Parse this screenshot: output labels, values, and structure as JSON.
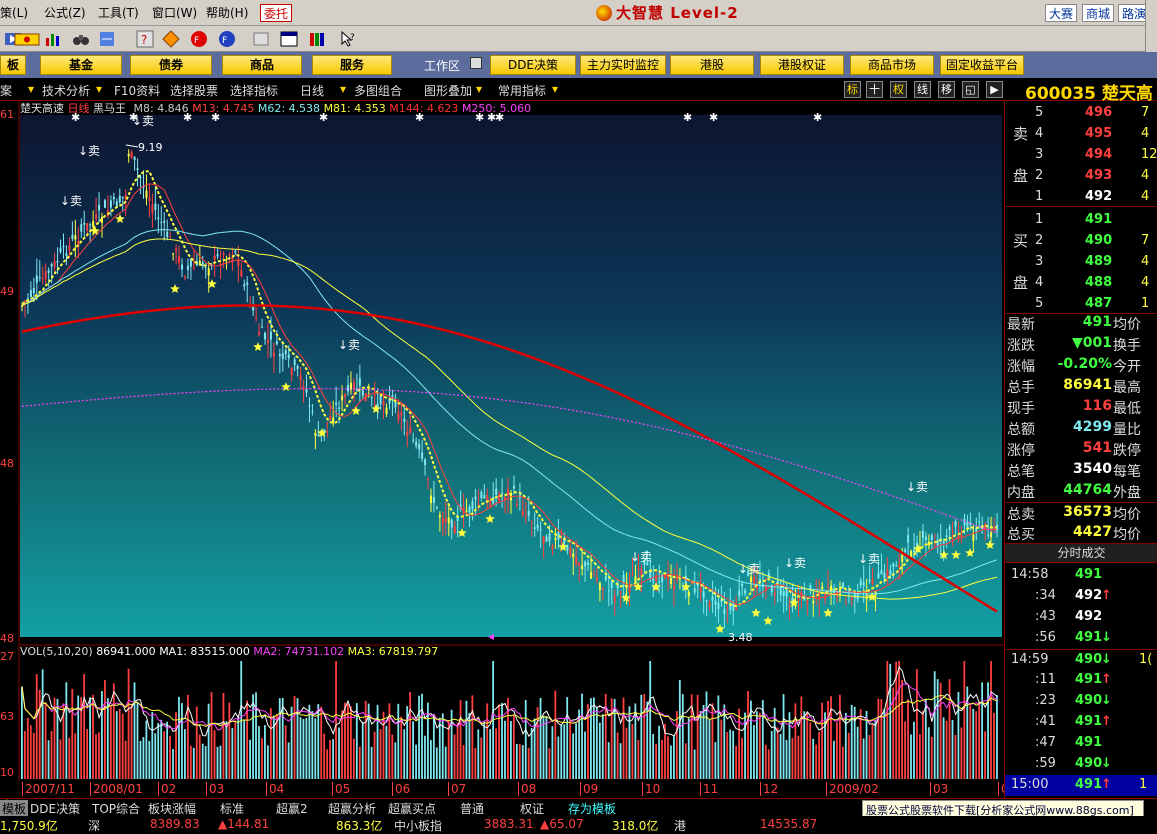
{
  "menubar": {
    "items": [
      "策(L)",
      "公式(Z)",
      "工具(T)",
      "窗口(W)",
      "帮助(H)"
    ],
    "weituo": "委托",
    "brand": "大智慧 Level-2",
    "right_buttons": [
      "大赛",
      "商城",
      "路演"
    ]
  },
  "navbar": {
    "buttons": [
      "板",
      "基金",
      "债券",
      "商品",
      "服务"
    ],
    "work_label": "工作区",
    "work_buttons": [
      "DDE决策",
      "主力实时监控",
      "港股",
      "港股权证",
      "商品市场",
      "固定收益平台"
    ]
  },
  "subbar": {
    "items": [
      "案",
      "技术分析",
      "F10资料",
      "选择股票",
      "选择指标",
      "日线",
      "多图组合",
      "图形叠加",
      "常用指标"
    ],
    "right_icons": [
      "标",
      "十",
      "权",
      "线",
      "移",
      "◱",
      "▶"
    ],
    "stock_code": "600035 楚天高"
  },
  "price_panel": {
    "stock_name": "楚天高速",
    "period": "日线",
    "indicator": "黑马王",
    "ma": [
      {
        "label": "M8: 4.846",
        "color": "#c8c8c8"
      },
      {
        "label": "M13: 4.745",
        "color": "#ff4040"
      },
      {
        "label": "M62: 4.538",
        "color": "#7fe8f0"
      },
      {
        "label": "M81: 4.353",
        "color": "#ffff40"
      },
      {
        "label": "M144: 4.623",
        "color": "#ff3030"
      },
      {
        "label": "M250: 5.060",
        "color": "#ff40ff"
      }
    ],
    "high_label": "9.19",
    "low_label": "3.48",
    "sell_label": "卖",
    "left_ticks": [
      "61",
      "49",
      "48",
      "48"
    ]
  },
  "volume_panel": {
    "title": "VOL(5,10,20)",
    "values": [
      {
        "label": "86941.000",
        "color": "#ffffff"
      },
      {
        "label": "MA1: 83515.000",
        "color": "#ffffff"
      },
      {
        "label": "MA2: 74731.102",
        "color": "#ff40ff"
      },
      {
        "label": "MA3: 67819.797",
        "color": "#ffff40"
      }
    ],
    "left_ticks": [
      "27",
      "63",
      "10"
    ]
  },
  "date_axis": [
    "2007/11",
    "2008/01",
    "02",
    "03",
    "04",
    "05",
    "06",
    "07",
    "08",
    "09",
    "10",
    "11",
    "12",
    "2009/02",
    "03",
    "04"
  ],
  "quotes": {
    "sell_label": [
      "卖",
      "盘"
    ],
    "buy_label": [
      "买",
      "盘"
    ],
    "sell": [
      {
        "level": "5",
        "price": "496",
        "vol": "7"
      },
      {
        "level": "4",
        "price": "495",
        "vol": "4"
      },
      {
        "level": "3",
        "price": "494",
        "vol": "12"
      },
      {
        "level": "2",
        "price": "493",
        "vol": "4"
      },
      {
        "level": "1",
        "price": "492",
        "vol": "4"
      }
    ],
    "buy": [
      {
        "level": "1",
        "price": "491",
        "vol": ""
      },
      {
        "level": "2",
        "price": "490",
        "vol": "7"
      },
      {
        "level": "3",
        "price": "489",
        "vol": "4"
      },
      {
        "level": "4",
        "price": "488",
        "vol": "4"
      },
      {
        "level": "5",
        "price": "487",
        "vol": "1"
      }
    ]
  },
  "stats": [
    {
      "label": "最新",
      "value": "491",
      "color": "#40ff40",
      "right": "均价"
    },
    {
      "label": "涨跌",
      "value": "▼001",
      "color": "#40ff40",
      "right": "换手"
    },
    {
      "label": "涨幅",
      "value": "-0.20%",
      "color": "#40ff40",
      "right": "今开"
    },
    {
      "label": "总手",
      "value": "86941",
      "color": "#ffff40",
      "right": "最高"
    },
    {
      "label": "现手",
      "value": "116",
      "color": "#ff4040",
      "right": "最低"
    },
    {
      "label": "总额",
      "value": "4299",
      "color": "#7fe8f0",
      "right": "量比"
    },
    {
      "label": "涨停",
      "value": "541",
      "color": "#ff4040",
      "right": "跌停"
    },
    {
      "label": "总笔",
      "value": "3540",
      "color": "#ffffff",
      "right": "每笔"
    },
    {
      "label": "内盘",
      "value": "44764",
      "color": "#40ff40",
      "right": "外盘"
    },
    {
      "label": "总卖",
      "value": "36573",
      "color": "#ffff40",
      "right": "均价"
    },
    {
      "label": "总买",
      "value": "4427",
      "color": "#ffff40",
      "right": "均价"
    }
  ],
  "ticks": {
    "title": "分时成交",
    "rows": [
      {
        "time": "14:58",
        "price": "491",
        "arrow": "",
        "color": "#40ff40",
        "vol": ""
      },
      {
        "time": ":34",
        "price": "492",
        "arrow": "↑",
        "color": "#ffffff",
        "vol": ""
      },
      {
        "time": ":43",
        "price": "492",
        "arrow": "",
        "color": "#ffffff",
        "vol": ""
      },
      {
        "time": ":56",
        "price": "491",
        "arrow": "↓",
        "color": "#40ff40",
        "vol": ""
      },
      {
        "time": "14:59",
        "price": "490",
        "arrow": "↓",
        "color": "#40ff40",
        "vol": "1("
      },
      {
        "time": ":11",
        "price": "491",
        "arrow": "↑",
        "color": "#40ff40",
        "vol": ""
      },
      {
        "time": ":23",
        "price": "490",
        "arrow": "↓",
        "color": "#40ff40",
        "vol": ""
      },
      {
        "time": ":41",
        "price": "491",
        "arrow": "↑",
        "color": "#40ff40",
        "vol": ""
      },
      {
        "time": ":47",
        "price": "491",
        "arrow": "",
        "color": "#40ff40",
        "vol": ""
      },
      {
        "time": ":59",
        "price": "490",
        "arrow": "↓",
        "color": "#40ff40",
        "vol": ""
      },
      {
        "time": "15:00",
        "price": "491",
        "arrow": "↑",
        "color": "#40ff40",
        "vol": "1"
      }
    ]
  },
  "tabs": [
    "模板",
    "DDE决策",
    "TOP综合",
    "板块涨幅",
    "标准",
    "超赢2",
    "超赢分析",
    "超赢买点",
    "普通",
    "权证",
    "存为模板"
  ],
  "ad_text": "股票公式股票软件下载[分析家公式网www.88gs.com]",
  "status": [
    "1,750.9亿",
    "深",
    "8389.83",
    "▲144.81",
    "863.3亿",
    "中小板指",
    "3883.31",
    "▲65.07",
    "318.0亿",
    "港",
    "14535.87"
  ],
  "chart_data": [
    {
      "type": "candlestick",
      "title": "楚天高速 日线",
      "x_axis": [
        "2007/11",
        "2008/01",
        "02",
        "03",
        "04",
        "05",
        "06",
        "07",
        "08",
        "09",
        "10",
        "11",
        "12",
        "2009/02",
        "03",
        "04"
      ],
      "annotations": [
        {
          "text": "9.19",
          "kind": "high"
        },
        {
          "text": "3.48",
          "kind": "low"
        }
      ],
      "series": [
        {
          "name": "M62",
          "color": "#7fe8f0"
        },
        {
          "name": "M81",
          "color": "#ffff40"
        },
        {
          "name": "M144",
          "color": "#ff3030"
        },
        {
          "name": "M250",
          "color": "#ff40ff"
        }
      ]
    },
    {
      "type": "bar",
      "title": "VOL(5,10,20)",
      "series": [
        {
          "name": "MA1",
          "values": [
            83515.0
          ]
        },
        {
          "name": "MA2",
          "values": [
            74731.102
          ]
        },
        {
          "name": "MA3",
          "values": [
            67819.797
          ]
        }
      ]
    }
  ]
}
